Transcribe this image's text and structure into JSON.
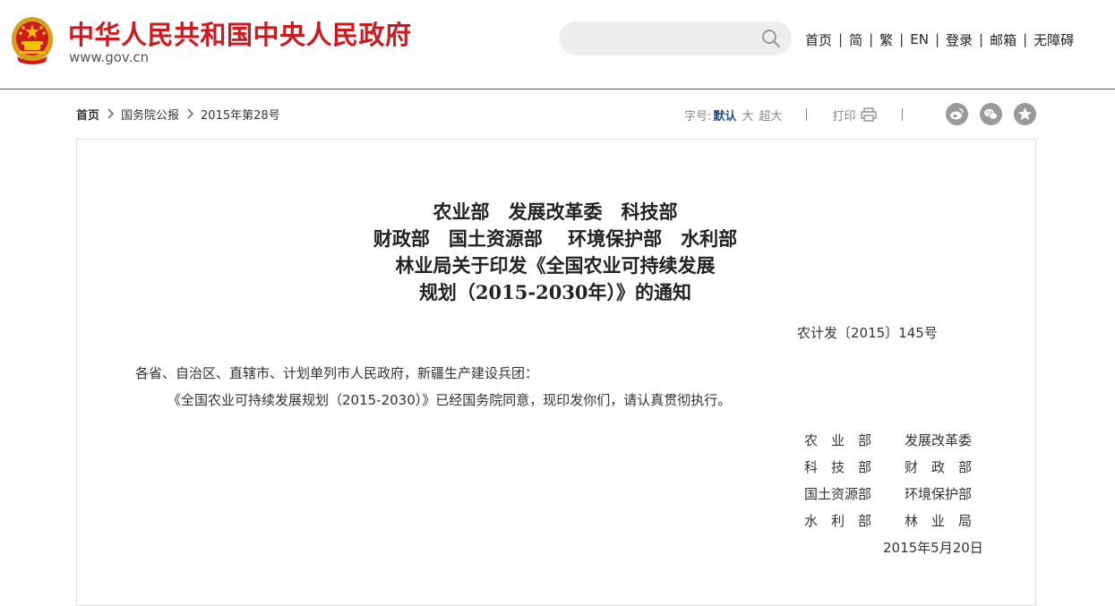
{
  "header": {
    "site_title": "中华人民共和国中央人民政府",
    "site_domain": "www.gov.cn",
    "emblem_icon": "national-emblem-icon",
    "title_color": "#d0191f",
    "search": {
      "placeholder": "",
      "value": "",
      "icon": "search-icon"
    },
    "nav": [
      "首页",
      "简",
      "繁",
      "EN",
      "登录",
      "邮箱",
      "无障碍"
    ]
  },
  "breadcrumb": [
    "首页",
    "国务院公报",
    "2015年第28号"
  ],
  "toolbar": {
    "font_size_label": "字号:",
    "font_sizes": [
      "默认",
      "大",
      "超大"
    ],
    "active_font_size": "默认",
    "print_label": "打印",
    "share_icons": [
      "weibo-icon",
      "wechat-icon",
      "favorite-star-icon"
    ],
    "accent_color": "#1b4f91"
  },
  "document": {
    "title_lines": [
      "农业部　发展改革委　科技部",
      "财政部　国土资源部　 环境保护部　水利部",
      "林业局关于印发《全国农业可持续发展",
      "规划（2015-2030年）》的通知"
    ],
    "doc_number": "农计发〔2015〕145号",
    "addressee": "各省、自治区、直辖市、计划单列市人民政府，新疆生产建设兵团：",
    "body": "《全国农业可持续发展规划（2015-2030）》已经国务院同意，现印发你们，请认真贯彻执行。",
    "signatories": [
      [
        "农　业　部",
        "发展改革委"
      ],
      [
        "科　技　部",
        "财　政　部"
      ],
      [
        "国土资源部",
        "环境保护部"
      ],
      [
        "水　利　部",
        "林　业　局"
      ]
    ],
    "date": "2015年5月20日"
  }
}
